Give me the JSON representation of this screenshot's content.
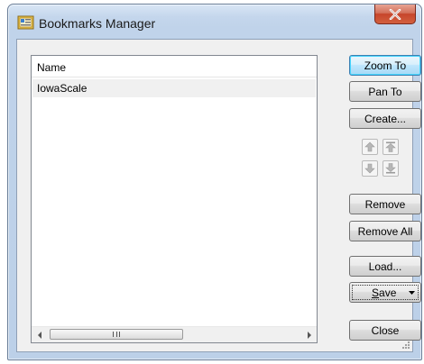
{
  "window": {
    "title": "Bookmarks Manager",
    "close_symbol": "x"
  },
  "list": {
    "column_header": "Name",
    "rows": [
      {
        "name": "IowaScale",
        "selected": true
      }
    ],
    "hscroll_thumb_glyph": "III"
  },
  "buttons": {
    "zoom_to": "Zoom To",
    "pan_to": "Pan To",
    "create": "Create...",
    "remove": "Remove",
    "remove_all": "Remove All",
    "load": "Load...",
    "save": "Save",
    "save_mnemonic": "S",
    "save_rest": "ave",
    "close": "Close"
  },
  "icons": {
    "app": "bookmarks-icon",
    "move_up": "arrow-up-icon",
    "move_top": "arrow-top-icon",
    "move_down": "arrow-down-icon",
    "move_bottom": "arrow-bottom-icon"
  },
  "colors": {
    "accent": "#3c7fb1",
    "close_red": "#c7452b",
    "selection": "#f0f0f0"
  }
}
